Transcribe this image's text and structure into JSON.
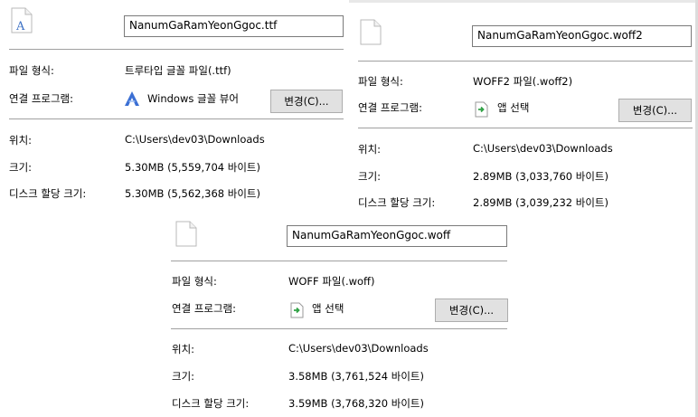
{
  "labels": {
    "file_type": "파일 형식:",
    "opens_with": "연결 프로그램:",
    "location": "위치:",
    "size": "크기:",
    "size_on_disk": "디스크 할당 크기:",
    "change_button": "변경(C)..."
  },
  "files": [
    {
      "name": "NanumGaRamYeonGgoc.ttf",
      "file_type": "트루타입 글꼴 파일(.ttf)",
      "opens_with": "Windows 글꼴 뷰어",
      "opens_with_icon": "font-viewer-icon",
      "location": "C:\\Users\\dev03\\Downloads",
      "size": "5.30MB (5,559,704 바이트)",
      "size_on_disk": "5.30MB (5,562,368 바이트)",
      "file_icon": "font-file-icon"
    },
    {
      "name": "NanumGaRamYeonGgoc.woff2",
      "file_type": "WOFF2 파일(.woff2)",
      "opens_with": "앱 선택",
      "opens_with_icon": "choose-app-icon",
      "location": "C:\\Users\\dev03\\Downloads",
      "size": "2.89MB (3,033,760 바이트)",
      "size_on_disk": "2.89MB (3,039,232 바이트)",
      "file_icon": "blank-file-icon"
    },
    {
      "name": "NanumGaRamYeonGgoc.woff",
      "file_type": "WOFF 파일(.woff)",
      "opens_with": "앱 선택",
      "opens_with_icon": "choose-app-icon",
      "location": "C:\\Users\\dev03\\Downloads",
      "size": "3.58MB (3,761,524 바이트)",
      "size_on_disk": "3.59MB (3,768,320 바이트)",
      "file_icon": "blank-file-icon"
    }
  ]
}
